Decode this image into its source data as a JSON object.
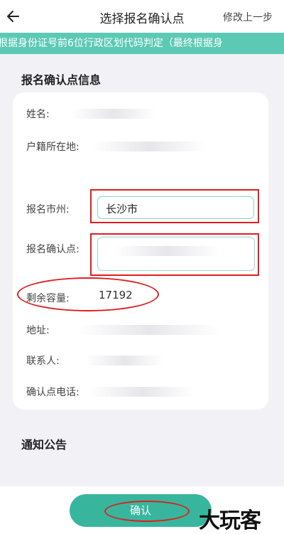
{
  "header": {
    "title": "选择报名确认点",
    "right_action": "修改上一步"
  },
  "notice": {
    "text": "根据身份证号前6位行政区划代码判定（最终根据身"
  },
  "info_section": {
    "title": "报名确认点信息",
    "fields": {
      "name": "姓名:",
      "household": "户籍所在地:",
      "city": "报名市州:",
      "city_value": "长沙市",
      "point": "报名确认点:",
      "capacity": "剩余容量:",
      "capacity_value": "17192",
      "address": "地址:",
      "contact": "联系人:",
      "phone": "确认点电话:"
    }
  },
  "announcement": {
    "title": "通知公告"
  },
  "footer": {
    "confirm_label": "确认"
  },
  "watermark": {
    "text": "大玩客"
  },
  "colors": {
    "accent": "#37b69d",
    "notice_bg": "#5cc9b5",
    "annotation_red": "#e01e1e"
  }
}
